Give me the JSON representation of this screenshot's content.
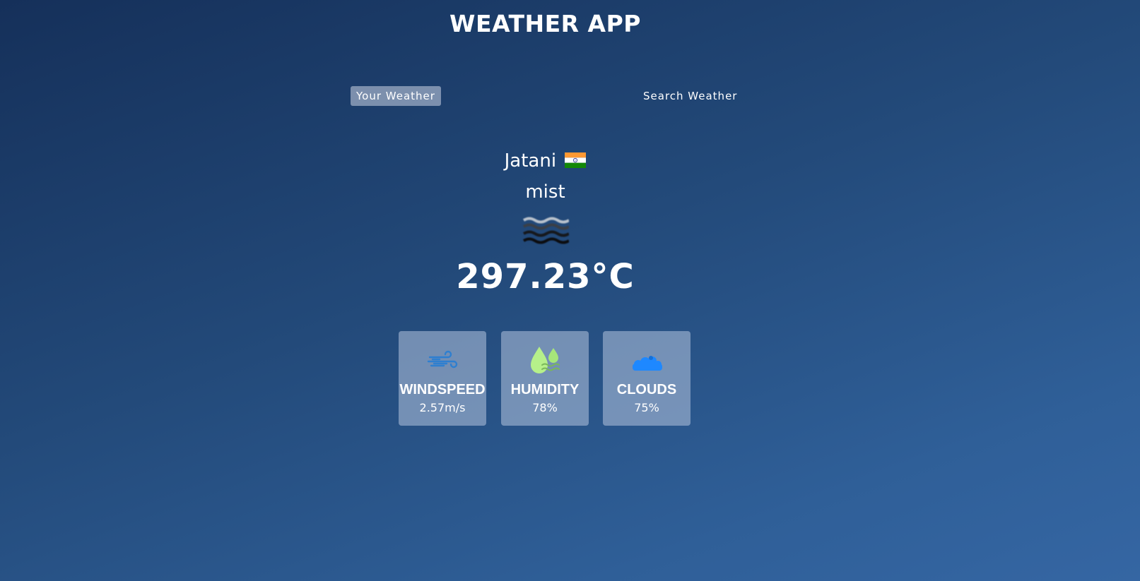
{
  "app": {
    "title": "WEATHER APP"
  },
  "tabs": [
    {
      "label": "Your Weather",
      "active": true
    },
    {
      "label": "Search Weather",
      "active": false
    }
  ],
  "weather": {
    "city": "Jatani",
    "country_flag_icon": "india-flag-icon",
    "description": "mist",
    "condition_icon": "mist-icon",
    "temperature": "297.23°C"
  },
  "stats": [
    {
      "icon": "wind-icon",
      "label": "WINDSPEED",
      "value": "2.57m/s",
      "icon_color": "#2e7fd0"
    },
    {
      "icon": "humidity-drop-icon",
      "label": "HUMIDITY",
      "value": "78%",
      "icon_color": "#b6f08a"
    },
    {
      "icon": "cloud-icon",
      "label": "CLOUDS",
      "value": "75%",
      "icon_color": "#1e88ff"
    }
  ],
  "colors": {
    "bg_top": "#15305a",
    "bg_bottom": "#3566a3",
    "card_bg": "rgba(180,196,222,0.55)",
    "active_tab_bg": "rgba(219,226,239,0.5)"
  }
}
